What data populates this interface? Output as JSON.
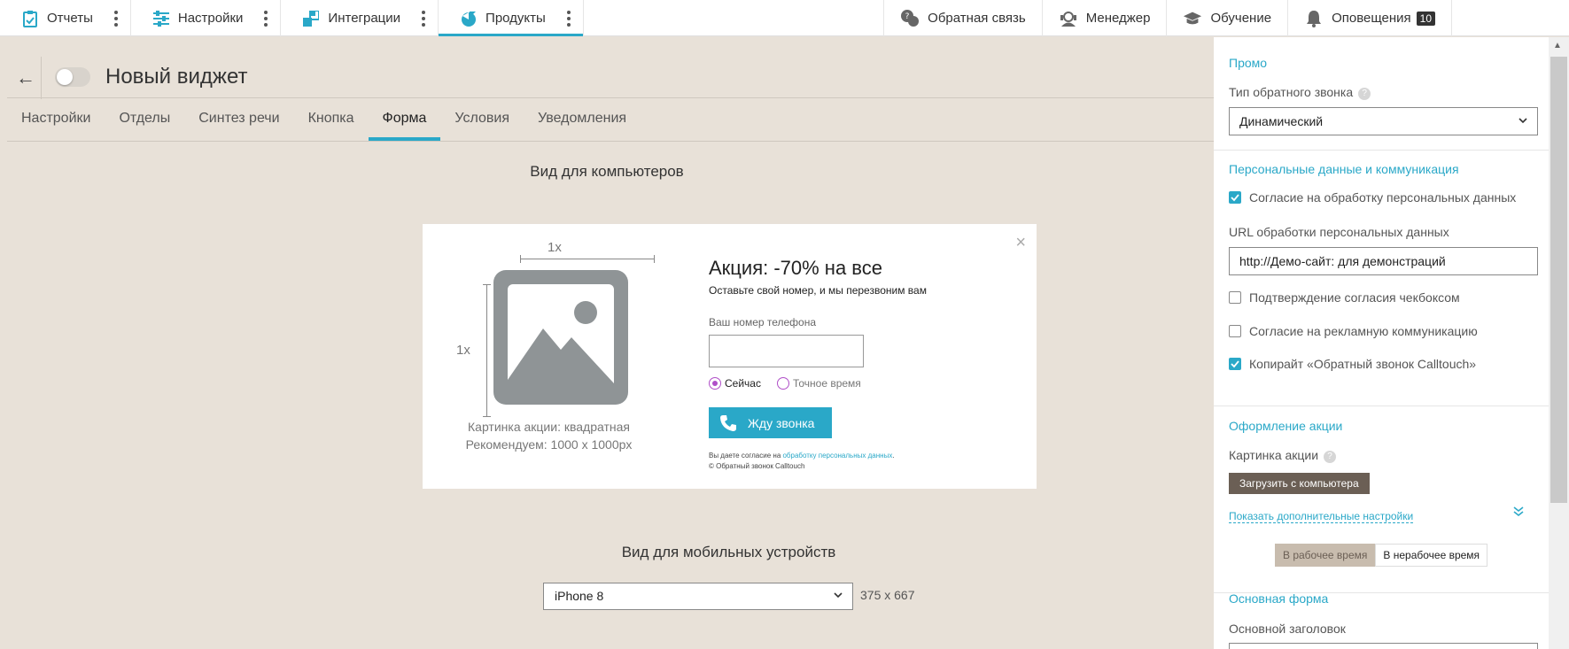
{
  "topnav": {
    "tabs": [
      {
        "label": "Отчеты",
        "icon": "clipboard-icon"
      },
      {
        "label": "Настройки",
        "icon": "sliders-icon"
      },
      {
        "label": "Интеграции",
        "icon": "integration-icon"
      },
      {
        "label": "Продукты",
        "icon": "products-icon"
      }
    ],
    "active_tab": "Продукты",
    "right": [
      {
        "label": "Обратная связь",
        "icon": "feedback-icon"
      },
      {
        "label": "Менеджер",
        "icon": "manager-icon"
      },
      {
        "label": "Обучение",
        "icon": "graduation-cap-icon"
      },
      {
        "label": "Оповещения",
        "icon": "bell-icon",
        "badge": "10"
      }
    ]
  },
  "header": {
    "back": "←",
    "title": "Новый виджет"
  },
  "subtabs": [
    "Настройки",
    "Отделы",
    "Синтез речи",
    "Кнопка",
    "Форма",
    "Условия",
    "Уведомления"
  ],
  "active_subtab": "Форма",
  "desktop": {
    "heading": "Вид для компьютеров",
    "close": "×",
    "dim_top": "1x",
    "dim_left": "1x",
    "image_caption_1": "Картинка акции: квадратная",
    "image_caption_2": "Рекомендуем: 1000 x 1000px",
    "promo_title": "Акция: -70% на все",
    "promo_sub": "Оставьте свой номер, и мы перезвоним вам",
    "phone_label": "Ваш номер телефона",
    "radio_now": "Сейчас",
    "radio_exact": "Точное время",
    "call_button": "Жду звонка",
    "consent_prefix": "Вы даете согласие на ",
    "consent_link": "обработку персональных данных",
    "consent_suffix": ".",
    "copyright": "© Обратный звонок Calltouch"
  },
  "mobile": {
    "heading": "Вид для мобильных устройств",
    "device": "iPhone 8",
    "size": "375 x 667"
  },
  "panel": {
    "promo_title": "Промо",
    "callback_type_label": "Тип обратного звонка",
    "callback_type_value": "Динамический",
    "personal_title": "Персональные данные и коммуникация",
    "cb_personal": "Согласие на обработку персональных данных",
    "url_label": "URL обработки персональных данных",
    "url_value": "http://Демо-сайт: для демонстраций",
    "cb_confirm": "Подтверждение согласия чекбоксом",
    "cb_ads": "Согласие на рекламную коммуникацию",
    "cb_copyright": "Копирайт «Обратный звонок Calltouch»",
    "design_title": "Оформление акции",
    "image_label": "Картинка акции",
    "upload_button": "Загрузить с компьютера",
    "show_more": "Показать дополнительные настройки",
    "seg_work": "В рабочее время",
    "seg_off": "В нерабочее время",
    "main_form_title": "Основная форма",
    "main_heading_label": "Основной заголовок"
  },
  "colors": {
    "accent": "#2aa8c8",
    "background": "#e8e1d8",
    "upload": "#6b5f55"
  }
}
